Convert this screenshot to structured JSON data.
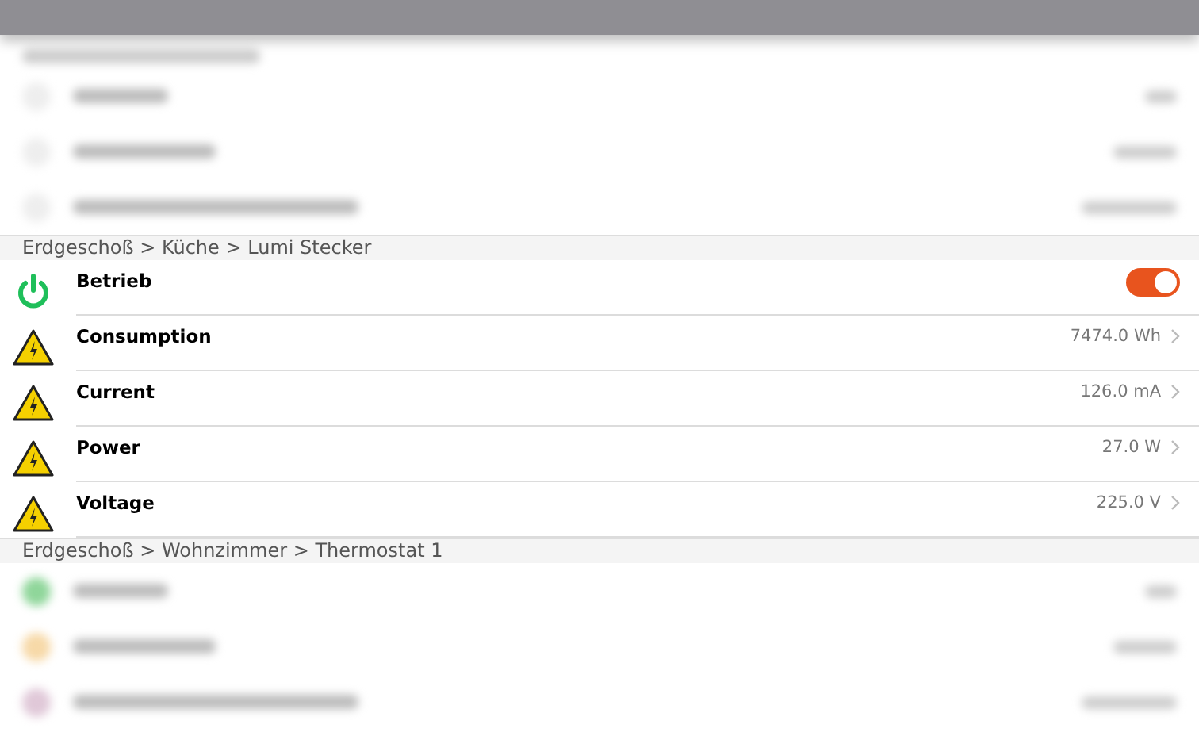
{
  "section": {
    "breadcrumb": "Erdgeschoß > Küche > Lumi Stecker",
    "rows": [
      {
        "kind": "switch",
        "label": "Betrieb",
        "on": true
      },
      {
        "kind": "reading",
        "label": "Consumption",
        "value": "7474.0 Wh"
      },
      {
        "kind": "reading",
        "label": "Current",
        "value": "126.0 mA"
      },
      {
        "kind": "reading",
        "label": "Power",
        "value": "27.0 W"
      },
      {
        "kind": "reading",
        "label": "Voltage",
        "value": "225.0 V"
      }
    ]
  },
  "next_section": {
    "breadcrumb": "Erdgeschoß > Wohnzimmer > Thermostat 1"
  }
}
